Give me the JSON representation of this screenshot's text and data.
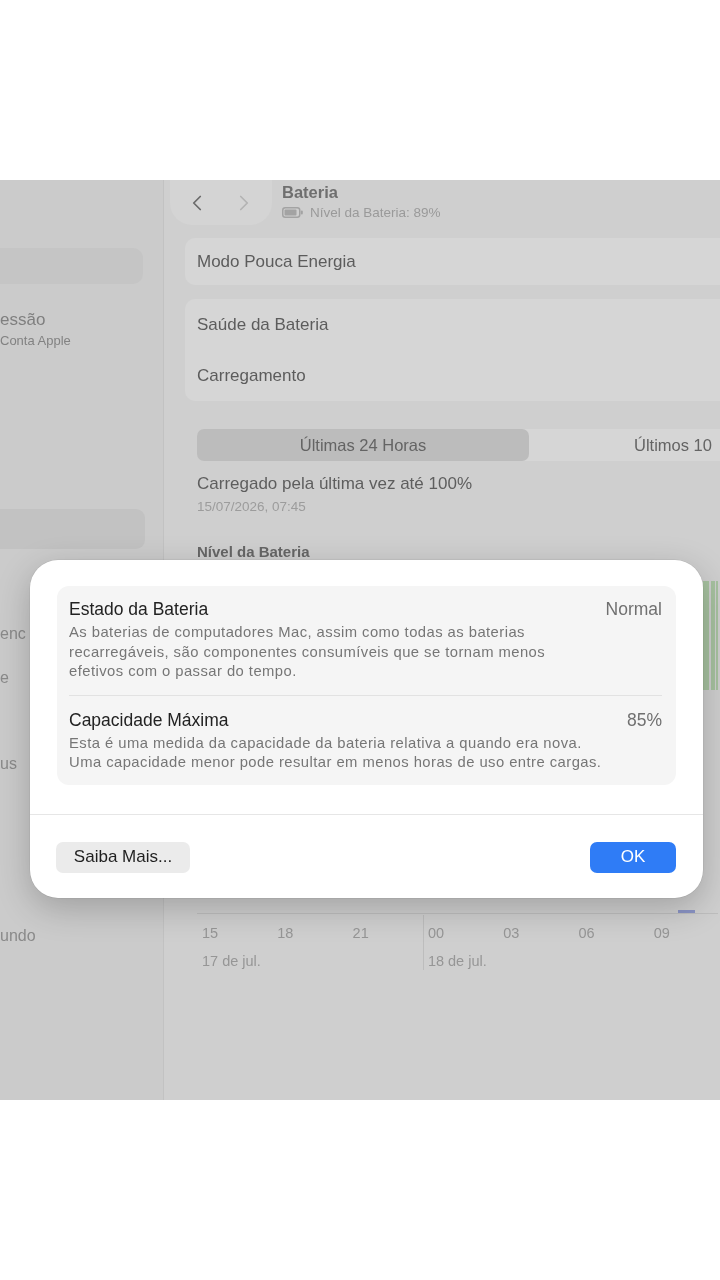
{
  "sidebar": {
    "account": {
      "title": "essão",
      "subtitle": "Conta Apple"
    },
    "items": [
      {
        "selected": true
      },
      {
        "label": "enc",
        "selected": false
      },
      {
        "label": "e",
        "selected": false
      },
      {
        "label": "us",
        "selected": false
      },
      {
        "label": "undo",
        "selected": false
      }
    ]
  },
  "header": {
    "back": {
      "disabled": false
    },
    "forward": {
      "disabled": true
    },
    "title": "Bateria",
    "subtitle": "Nível da Bateria: 89%"
  },
  "groups": [
    {
      "rows": [
        {
          "label": "Modo Pouca Energia"
        }
      ]
    },
    {
      "rows": [
        {
          "label": "Saúde da Bateria"
        },
        {
          "label": "Carregamento"
        }
      ]
    }
  ],
  "period_tabs": [
    {
      "label": "Últimas 24 Horas",
      "selected": true
    },
    {
      "label": "Últimos 10",
      "selected": false
    }
  ],
  "last_charge": {
    "text": "Carregado pela última vez até 100%",
    "time": "15/07/2026, 07:45"
  },
  "battery_level": {
    "title": "Nível da Bateria",
    "days": [
      {
        "date": "17 de jul.",
        "hours": [
          "15",
          "18",
          "21"
        ]
      },
      {
        "date": "18 de jul.",
        "hours": [
          "00",
          "03",
          "06",
          "09"
        ]
      }
    ]
  },
  "dialog": {
    "items": [
      {
        "title": "Estado da Bateria",
        "value": "Normal",
        "description": "As baterias de computadores Mac, assim como todas as baterias recarregáveis, são componentes consumíveis que se tornam menos efetivos com o passar do tempo."
      },
      {
        "title": "Capacidade Máxima",
        "value": "85%",
        "description": "Esta é uma medida da capacidade da bateria relativa a quando era nova. Uma capacidade menor pode resultar em menos horas de uso entre cargas."
      }
    ],
    "buttons": [
      {
        "label": "Saiba Mais...",
        "kind": "secondary"
      },
      {
        "label": "OK",
        "kind": "primary"
      }
    ]
  }
}
